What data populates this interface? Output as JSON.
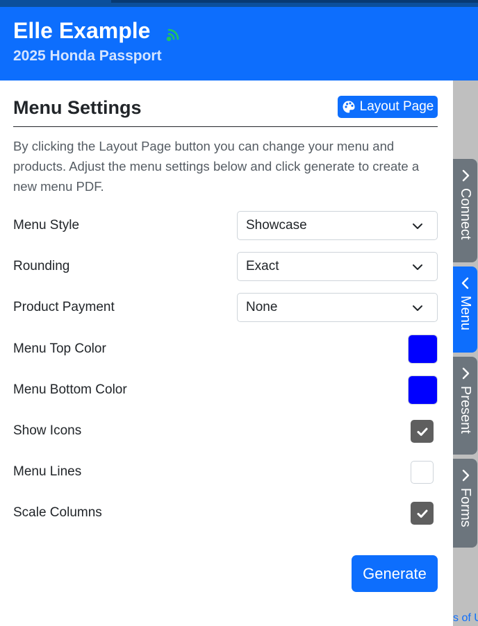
{
  "header": {
    "customer_name": "Elle Example",
    "vehicle": "2025 Honda Passport",
    "status_icon": "signal-icon",
    "status_color": "#22c55e"
  },
  "main": {
    "title": "Menu Settings",
    "layout_button_label": "Layout Page",
    "description": "By clicking the Layout Page button you can change your menu and products. Adjust the menu settings below and click generate to create a new menu PDF.",
    "settings": {
      "menu_style": {
        "label": "Menu Style",
        "value": "Showcase"
      },
      "rounding": {
        "label": "Rounding",
        "value": "Exact"
      },
      "product_payment": {
        "label": "Product Payment",
        "value": "None"
      },
      "menu_top_color": {
        "label": "Menu Top Color",
        "value": "#0000ff"
      },
      "menu_bottom_color": {
        "label": "Menu Bottom Color",
        "value": "#0000ff"
      },
      "show_icons": {
        "label": "Show Icons",
        "checked": true
      },
      "menu_lines": {
        "label": "Menu Lines",
        "checked": false
      },
      "scale_columns": {
        "label": "Scale Columns",
        "checked": true
      }
    },
    "generate_label": "Generate"
  },
  "side_tabs": [
    {
      "label": "Connect",
      "active": false
    },
    {
      "label": "Menu",
      "active": true
    },
    {
      "label": "Present",
      "active": false
    },
    {
      "label": "Forms",
      "active": false
    }
  ],
  "footer_link_fragment": "s of U",
  "colors": {
    "primary": "#0d6efd",
    "tab_inactive": "#6c757d",
    "checkbox_checked": "#5f5f5f"
  }
}
